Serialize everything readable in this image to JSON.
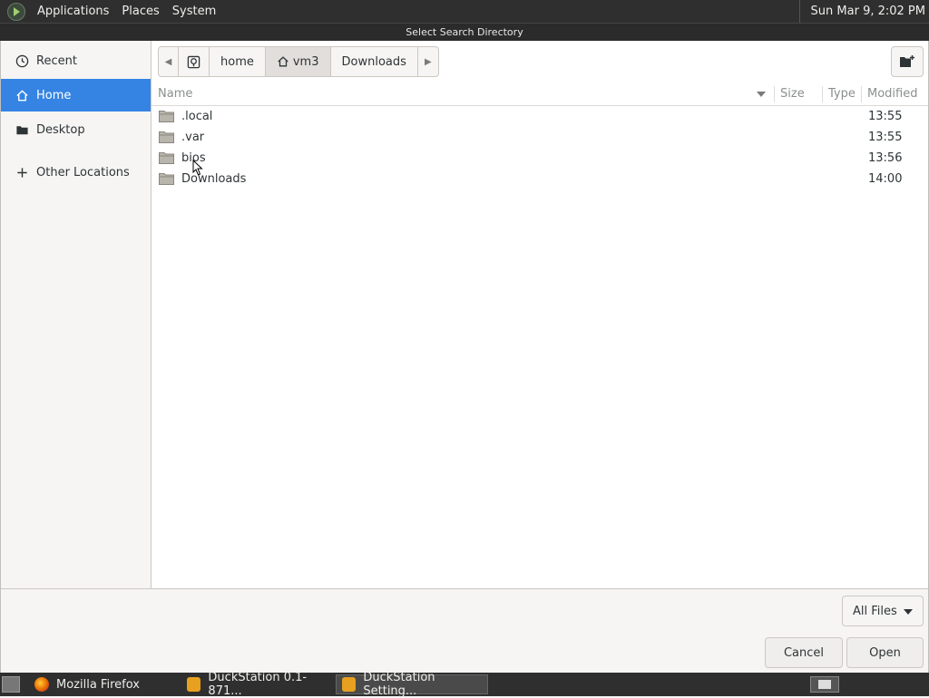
{
  "top_panel": {
    "menus": [
      "Applications",
      "Places",
      "System"
    ],
    "clock": "Sun Mar  9,  2:02 PM"
  },
  "dialog": {
    "title": "Select Search Directory"
  },
  "sidebar": {
    "items": [
      {
        "label": "Recent",
        "icon": "clock-icon"
      },
      {
        "label": "Home",
        "icon": "home-icon"
      },
      {
        "label": "Desktop",
        "icon": "folder-icon"
      },
      {
        "label": "Other Locations",
        "icon": "plus-icon"
      }
    ],
    "active": "Home"
  },
  "pathbar": {
    "segments": [
      "home",
      "vm3",
      "Downloads"
    ]
  },
  "columns": {
    "name": "Name",
    "size": "Size",
    "type": "Type",
    "modified": "Modified"
  },
  "files": [
    {
      "name": ".local",
      "modified": "13:55"
    },
    {
      "name": ".var",
      "modified": "13:55"
    },
    {
      "name": "bios",
      "modified": "13:56"
    },
    {
      "name": "Downloads",
      "modified": "14:00"
    }
  ],
  "footer": {
    "filter": "All Files",
    "cancel": "Cancel",
    "open": "Open"
  },
  "taskbar": {
    "items": [
      {
        "label": "Mozilla Firefox",
        "icon": "firefox-icon"
      },
      {
        "label": "DuckStation 0.1-871...",
        "icon": "duckstation-icon"
      },
      {
        "label": "DuckStation Setting...",
        "icon": "duckstation-icon"
      }
    ]
  },
  "colors": {
    "accent": "#3584e4",
    "panel": "#2f2f2f"
  }
}
